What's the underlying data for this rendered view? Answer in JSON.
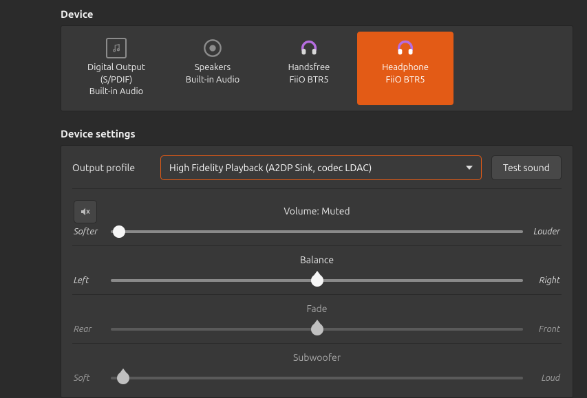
{
  "section_device_title": "Device",
  "section_settings_title": "Device settings",
  "devices": [
    {
      "line1": "Digital Output (S/PDIF)",
      "line2": "Built-in Audio",
      "icon": "music-note-icon",
      "selected": false
    },
    {
      "line1": "Speakers",
      "line2": "Built-in Audio",
      "icon": "speaker-icon",
      "selected": false
    },
    {
      "line1": "Handsfree",
      "line2": "FiiO BTR5",
      "icon": "headset-icon",
      "selected": false
    },
    {
      "line1": "Headphone",
      "line2": "FiiO BTR5",
      "icon": "headset-icon",
      "selected": true
    }
  ],
  "profile": {
    "label": "Output profile",
    "value": "High Fidelity Playback (A2DP Sink, codec LDAC)",
    "test_button": "Test sound"
  },
  "volume": {
    "title": "Volume: Muted",
    "muted": true,
    "left_label": "Softer",
    "right_label": "Louder",
    "position_pct": 2
  },
  "balance": {
    "title": "Balance",
    "left_label": "Left",
    "right_label": "Right",
    "position_pct": 50
  },
  "fade": {
    "title": "Fade",
    "left_label": "Rear",
    "right_label": "Front",
    "position_pct": 50,
    "disabled": true
  },
  "subwoofer": {
    "title": "Subwoofer",
    "left_label": "Soft",
    "right_label": "Loud",
    "position_pct": 3,
    "disabled": true
  }
}
